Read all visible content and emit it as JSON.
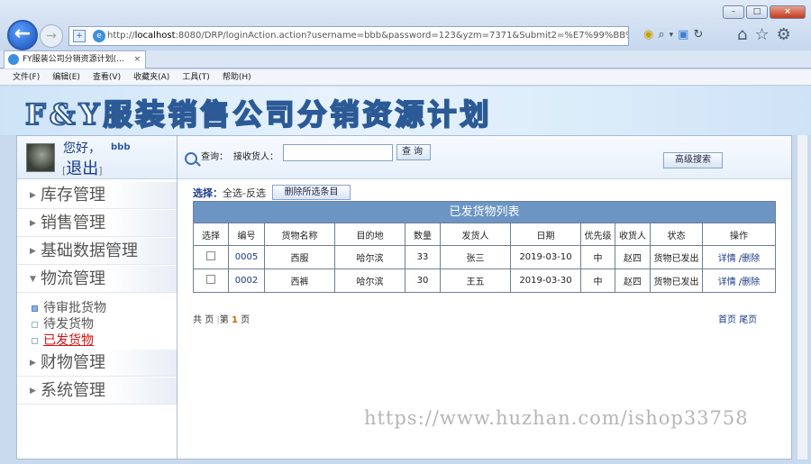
{
  "browser": {
    "url_host": "localhost",
    "url_rest": ":8080/DRP/loginAction.action?username=bbb&password=123&yzm=7371&Submit2=%E7%99%BB%E5%BD%95",
    "tab_title": "FY服装公司分销资源计划(...",
    "tab_close": "×",
    "back_icon": "←",
    "fwd_icon": "→",
    "win_min": "–",
    "win_max": "□",
    "win_close": "×"
  },
  "menubar": [
    "文件(F)",
    "编辑(E)",
    "查看(V)",
    "收藏夹(A)",
    "工具(T)",
    "帮助(H)"
  ],
  "banner": {
    "title": "F&Y服装销售公司分销资源计划"
  },
  "user": {
    "greeting": "您好，",
    "name": "bbb",
    "logout": "退出",
    "bracket_open": "[",
    "bracket_close": "]"
  },
  "sidebar": {
    "inventory": "库存管理",
    "sales": "销售管理",
    "basedata": "基础数据管理",
    "logistics": "物流管理",
    "sub_pending": "待审批货物",
    "sub_tosend": "待发货物",
    "sub_sent": "已发货物",
    "finance": "财物管理",
    "system": "系统管理"
  },
  "search": {
    "label": "查询：",
    "field_label": "接收货人：",
    "value": "",
    "button": "查询",
    "advanced": "高级搜索"
  },
  "select": {
    "label": "选择：",
    "options": "全选-反选",
    "delete_button": "删除所选条目"
  },
  "table": {
    "caption": "已发货物列表",
    "headers": [
      "选择",
      "编号",
      "货物名称",
      "目的地",
      "数量",
      "发货人",
      "日期",
      "优先级",
      "收货人",
      "状态",
      "操作"
    ],
    "rows": [
      {
        "id": "0005",
        "name": "西服",
        "dest": "哈尔滨",
        "qty": "33",
        "sender": "张三",
        "date": "2019-03-10",
        "priority": "中",
        "receiver": "赵四",
        "status": "货物已发出",
        "detail": "详情",
        "sep": "/",
        "delete": "删除"
      },
      {
        "id": "0002",
        "name": "西裤",
        "dest": "哈尔滨",
        "qty": "30",
        "sender": "王五",
        "date": "2019-03-30",
        "priority": "中",
        "receiver": "赵四",
        "status": "货物已发出",
        "detail": "详情",
        "sep": "/",
        "delete": "删除"
      }
    ]
  },
  "pager": {
    "total_prefix": "共",
    "total_suffix": "页",
    "sep": "|",
    "page_prefix": "第",
    "page": "1",
    "page_suffix": "页",
    "first": "首页",
    "last": "尾页"
  },
  "watermark": "https://www.huzhan.com/ishop33758"
}
